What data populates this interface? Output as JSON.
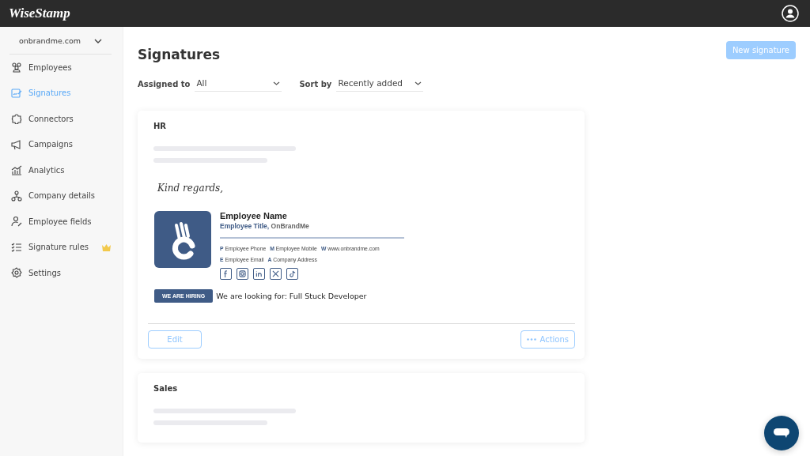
{
  "header": {
    "logo": "WiseStamp"
  },
  "sidebar": {
    "account": "onbrandme.com",
    "items": [
      {
        "label": "Employees",
        "selected": false,
        "premium": false
      },
      {
        "label": "Signatures",
        "selected": true,
        "premium": false
      },
      {
        "label": "Connectors",
        "selected": false,
        "premium": false
      },
      {
        "label": "Campaigns",
        "selected": false,
        "premium": false
      },
      {
        "label": "Analytics",
        "selected": false,
        "premium": false
      },
      {
        "label": "Company details",
        "selected": false,
        "premium": false
      },
      {
        "label": "Employee fields",
        "selected": false,
        "premium": false
      },
      {
        "label": "Signature rules",
        "selected": false,
        "premium": true
      },
      {
        "label": "Settings",
        "selected": false,
        "premium": false
      }
    ]
  },
  "page": {
    "title": "Signatures",
    "new_button": "New signature",
    "filters": [
      {
        "label": "Assigned to",
        "value": "All"
      },
      {
        "label": "Sort by",
        "value": "Recently added"
      }
    ]
  },
  "cards": [
    {
      "name": "HR",
      "signature": {
        "closing": "Kind regards,",
        "employee_name": "Employee Name",
        "title": "Employee Title,",
        "company": "OnBrandMe",
        "contacts": [
          [
            {
              "key": "P",
              "value": "Employee Phone"
            },
            {
              "key": "M",
              "value": "Employee Mobile"
            },
            {
              "key": "W",
              "value": "www.onbrandme.com"
            }
          ],
          [
            {
              "key": "E",
              "value": "Employee Email"
            },
            {
              "key": "A",
              "value": "Company Address"
            }
          ]
        ],
        "banner": {
          "badge": "WE ARE HIRING",
          "text": "We are looking for: Full Stuck Developer"
        }
      },
      "edit": "Edit",
      "actions": "Actions"
    },
    {
      "name": "Sales"
    }
  ]
}
